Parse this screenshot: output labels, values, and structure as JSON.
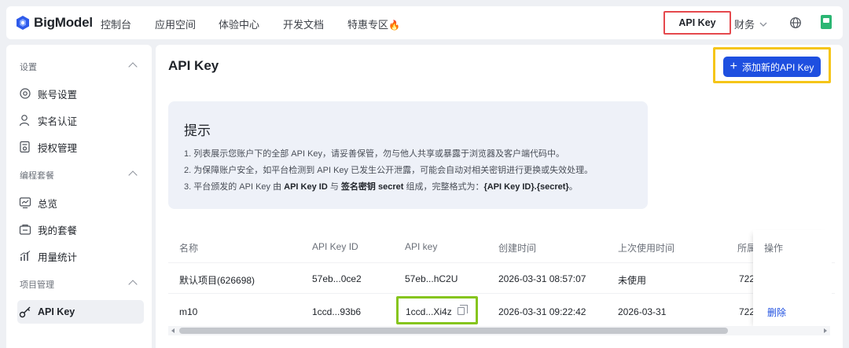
{
  "brand": {
    "name": "BigModel",
    "logo_icon": "bigmodel-logo-icon",
    "color": "#2f5bea"
  },
  "topnav": {
    "items": [
      "控制台",
      "应用空间",
      "体验中心",
      "开发文档",
      "特惠专区"
    ],
    "promo_icon": "fire-icon",
    "api_key": "API Key",
    "finance": "财务",
    "globe_icon": "globe-icon",
    "avatar_icon": "avatar-icon"
  },
  "sidebar": {
    "sections": [
      {
        "title": "设置",
        "items": [
          {
            "label": "账号设置",
            "icon": "settings-icon"
          },
          {
            "label": "实名认证",
            "icon": "user-icon"
          },
          {
            "label": "授权管理",
            "icon": "authorization-icon"
          }
        ]
      },
      {
        "title": "编程套餐",
        "items": [
          {
            "label": "总览",
            "icon": "dashboard-icon"
          },
          {
            "label": "我的套餐",
            "icon": "package-icon"
          },
          {
            "label": "用量统计",
            "icon": "bar-chart-icon"
          }
        ]
      },
      {
        "title": "项目管理",
        "items": [
          {
            "label": "API Key",
            "icon": "key-icon",
            "active": true
          }
        ]
      }
    ]
  },
  "main": {
    "title": "API Key",
    "add_button": "添加新的API Key",
    "accent": "#1e4fe0",
    "tip": {
      "title": "提示",
      "line1": "1. 列表展示您账户下的全部 API Key，请妥善保管，勿与他人共享或暴露于浏览器及客户端代码中。",
      "line2": "2. 为保障账户安全，如平台检测到 API Key 已发生公开泄露，可能会自动对相关密钥进行更换或失效处理。",
      "line3_a": "3. 平台颁发的 API Key 由 ",
      "line3_b": "API Key ID",
      "line3_c": " 与 ",
      "line3_d": "签名密钥 secret",
      "line3_e": " 组成，完整格式为：",
      "line3_f": "{API Key ID}.{secret}",
      "line3_g": "。"
    },
    "table": {
      "columns": [
        "名称",
        "API Key ID",
        "API key",
        "创建时间",
        "上次使用时间",
        "所属",
        "操作"
      ],
      "rows": [
        {
          "name": "默认项目(626698)",
          "key_id": "57eb...0ce2",
          "api_key": "57eb...hC2U",
          "created": "2026-03-31 08:57:07",
          "last_used": "未使用",
          "owner": "722",
          "action": ""
        },
        {
          "name": "m10",
          "key_id": "1ccd...93b6",
          "api_key": "1ccd...Xi4z",
          "created": "2026-03-31 09:22:42",
          "last_used": "2026-03-31",
          "owner": "722",
          "action": "删除"
        }
      ]
    }
  }
}
